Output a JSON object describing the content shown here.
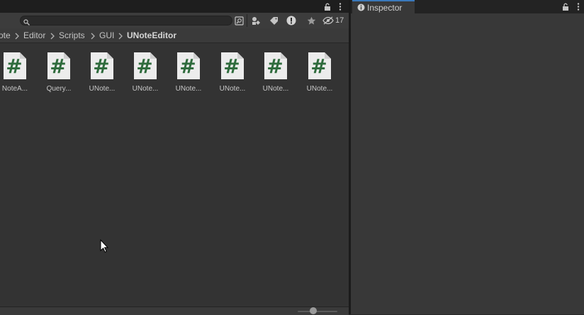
{
  "project": {
    "search": {
      "value": "",
      "placeholder": ""
    },
    "hidden_count": "17",
    "breadcrumb": [
      "ote",
      "Editor",
      "Scripts",
      "GUI",
      "UNoteEditor"
    ],
    "assets": [
      {
        "label": "NoteA..."
      },
      {
        "label": "Query..."
      },
      {
        "label": "UNote..."
      },
      {
        "label": "UNote..."
      },
      {
        "label": "UNote..."
      },
      {
        "label": "UNote..."
      },
      {
        "label": "UNote..."
      },
      {
        "label": "UNote..."
      }
    ],
    "zoom_level": 0.3,
    "toolbar_icons": [
      "create-search-icon",
      "search-by-type-icon",
      "search-by-label-icon",
      "log-level-icon",
      "favorite-icon",
      "hidden-packages-icon"
    ],
    "asset_icon": "csharp-script-icon"
  },
  "inspector": {
    "title": "Inspector",
    "tab_icon": "info-icon"
  },
  "colors": {
    "csharp_hash": "#2e6b3c",
    "tab_accent": "#3a79bb",
    "panel_bg": "#333333",
    "inspector_bg": "#383838"
  }
}
